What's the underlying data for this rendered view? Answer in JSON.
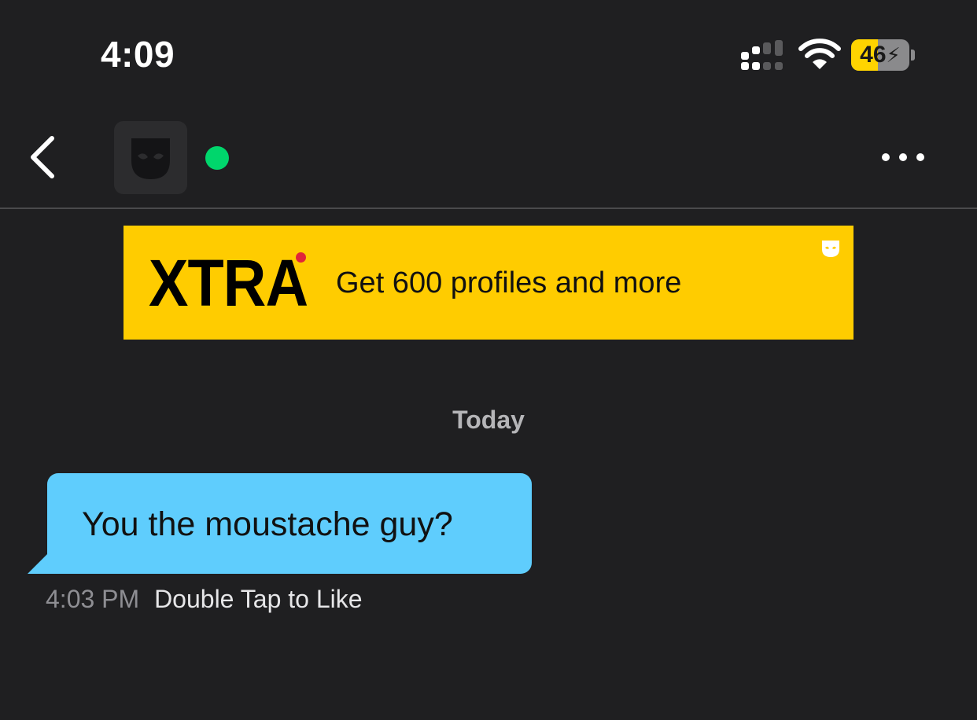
{
  "status_bar": {
    "time": "4:09",
    "battery_level": "46",
    "battery_fraction": 0.46,
    "icons": [
      "signal-icon",
      "wifi-icon",
      "battery-charging-icon"
    ]
  },
  "nav": {
    "back_icon": "chevron-left-icon",
    "avatar_icon": "grindr-mask-icon",
    "online_status_color": "#00d66c",
    "more_icon": "ellipsis-icon"
  },
  "banner": {
    "logo_text": "XTRA",
    "text": "Get 600 profiles and more",
    "background_color": "#ffcc00",
    "corner_icon": "grindr-mask-icon"
  },
  "chat": {
    "date_label": "Today",
    "messages": [
      {
        "text": "You the moustache guy?",
        "time": "4:03 PM",
        "action": "Double Tap to Like",
        "bubble_color": "#5fcdfd"
      }
    ]
  },
  "colors": {
    "background": "#1f1f21",
    "accent": "#ffcc00",
    "online": "#00d66c"
  }
}
